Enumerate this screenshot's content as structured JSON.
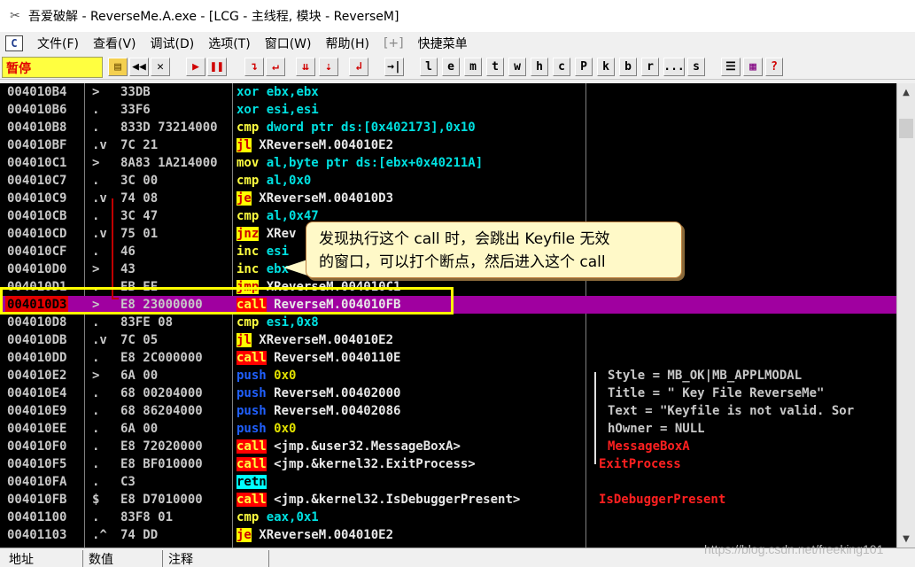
{
  "window": {
    "title": "吾爱破解 - ReverseMe.A.exe - [LCG - 主线程, 模块 - ReverseM]"
  },
  "menu": [
    "文件(F)",
    "查看(V)",
    "调试(D)",
    "选项(T)",
    "窗口(W)",
    "帮助(H)",
    "[+]",
    "快捷菜单"
  ],
  "toolbar": {
    "status": "暂停",
    "buttons": [
      "open",
      "rewind",
      "close",
      "run",
      "pause",
      "step-into",
      "step-over",
      "trace-into",
      "trace-over",
      "execute-till-return",
      "goto",
      "l",
      "e",
      "m",
      "t",
      "w",
      "h",
      "c",
      "P",
      "k",
      "b",
      "r",
      "...",
      "s",
      "list",
      "grid",
      "help"
    ],
    "letter_labels": [
      "l",
      "e",
      "m",
      "t",
      "w",
      "h",
      "c",
      "P",
      "k",
      "b",
      "r",
      "...",
      "s",
      "?"
    ]
  },
  "callout": {
    "line1": "发现执行这个 call 时，会跳出 Keyfile 无效",
    "line2": "的窗口，可以打个断点，然后进入这个 call"
  },
  "rows": [
    {
      "addr": "004010B4",
      "mark": ">",
      "hex": "33DB",
      "mn": "xor",
      "ops": "ebx,ebx",
      "cmt": ""
    },
    {
      "addr": "004010B6",
      "mark": ".",
      "hex": "33F6",
      "mn": "xor",
      "ops": "esi,esi",
      "cmt": ""
    },
    {
      "addr": "004010B8",
      "mark": ".",
      "hex": "833D 73214000",
      "mn": "cmp",
      "ops": "dword ptr ds:[0x402173],0x10",
      "cmt": ""
    },
    {
      "addr": "004010BF",
      "mark": ".v",
      "hex": "7C 21",
      "mn": "jl",
      "ops": "XReverseM.004010E2",
      "cmt": ""
    },
    {
      "addr": "004010C1",
      "mark": ">",
      "hex": "8A83 1A214000",
      "mn": "mov",
      "ops": "al,byte ptr ds:[ebx+0x40211A]",
      "cmt": ""
    },
    {
      "addr": "004010C7",
      "mark": ".",
      "hex": "3C 00",
      "mn": "cmp",
      "ops": "al,0x0",
      "cmt": ""
    },
    {
      "addr": "004010C9",
      "mark": ".v",
      "hex": "74 08",
      "mn": "je",
      "ops": "XReverseM.004010D3",
      "cmt": ""
    },
    {
      "addr": "004010CB",
      "mark": ".",
      "hex": "3C 47",
      "mn": "cmp",
      "ops": "al,0x47",
      "cmt": ""
    },
    {
      "addr": "004010CD",
      "mark": ".v",
      "hex": "75 01",
      "mn": "jnz",
      "ops": "XRev",
      "cmt": ""
    },
    {
      "addr": "004010CF",
      "mark": ".",
      "hex": "46",
      "mn": "inc",
      "ops": "esi",
      "cmt": ""
    },
    {
      "addr": "004010D0",
      "mark": ">",
      "hex": "43",
      "mn": "inc",
      "ops": "ebx",
      "cmt": ""
    },
    {
      "addr": "004010D1",
      "mark": ".",
      "hex": "EB EE",
      "mn": "jmp",
      "ops": "XReverseM.004010C1",
      "cmt": ""
    },
    {
      "addr": "004010D3",
      "mark": ">",
      "hex": "E8 23000000",
      "mn": "call",
      "ops": "ReverseM.004010FB",
      "cmt": ""
    },
    {
      "addr": "004010D8",
      "mark": ".",
      "hex": "83FE 08",
      "mn": "cmp",
      "ops": "esi,0x8",
      "cmt": ""
    },
    {
      "addr": "004010DB",
      "mark": ".v",
      "hex": "7C 05",
      "mn": "jl",
      "ops": "XReverseM.004010E2",
      "cmt": ""
    },
    {
      "addr": "004010DD",
      "mark": ".",
      "hex": "E8 2C000000",
      "mn": "call",
      "ops": "ReverseM.0040110E",
      "cmt": ""
    },
    {
      "addr": "004010E2",
      "mark": ">",
      "hex": "6A 00",
      "mn": "push",
      "ops": "0x0",
      "cmt": "Style = MB_OK|MB_APPLMODAL"
    },
    {
      "addr": "004010E4",
      "mark": ".",
      "hex": "68 00204000",
      "mn": "push",
      "ops": "ReverseM.00402000",
      "cmt": "Title = \" Key File ReverseMe\""
    },
    {
      "addr": "004010E9",
      "mark": ".",
      "hex": "68 86204000",
      "mn": "push",
      "ops": "ReverseM.00402086",
      "cmt": "Text = \"Keyfile is not valid. Sor"
    },
    {
      "addr": "004010EE",
      "mark": ".",
      "hex": "6A 00",
      "mn": "push",
      "ops": "0x0",
      "cmt": "hOwner = NULL"
    },
    {
      "addr": "004010F0",
      "mark": ".",
      "hex": "E8 72020000",
      "mn": "call",
      "ops": "<jmp.&user32.MessageBoxA>",
      "cmt": "MessageBoxA"
    },
    {
      "addr": "004010F5",
      "mark": ".",
      "hex": "E8 BF010000",
      "mn": "call",
      "ops": "<jmp.&kernel32.ExitProcess>",
      "cmt": "ExitProcess"
    },
    {
      "addr": "004010FA",
      "mark": ".",
      "hex": "C3",
      "mn": "retn",
      "ops": "",
      "cmt": ""
    },
    {
      "addr": "004010FB",
      "mark": "$",
      "hex": "E8 D7010000",
      "mn": "call",
      "ops": "<jmp.&kernel32.IsDebuggerPresent>",
      "cmt": "IsDebuggerPresent"
    },
    {
      "addr": "00401100",
      "mark": ".",
      "hex": "83F8 01",
      "mn": "cmp",
      "ops": "eax,0x1",
      "cmt": ""
    },
    {
      "addr": "00401103",
      "mark": ".^",
      "hex": "74 DD",
      "mn": "je",
      "ops": "XReverseM.004010E2",
      "cmt": ""
    }
  ],
  "bottom": {
    "col1": "地址",
    "col2": "数值",
    "col3": "注释"
  },
  "watermark": "https://blog.csdn.net/freeking101",
  "colors": {
    "selected_row": "#a000a0",
    "status_bg": "#ffff40",
    "highlight_box": "#ffff00"
  }
}
